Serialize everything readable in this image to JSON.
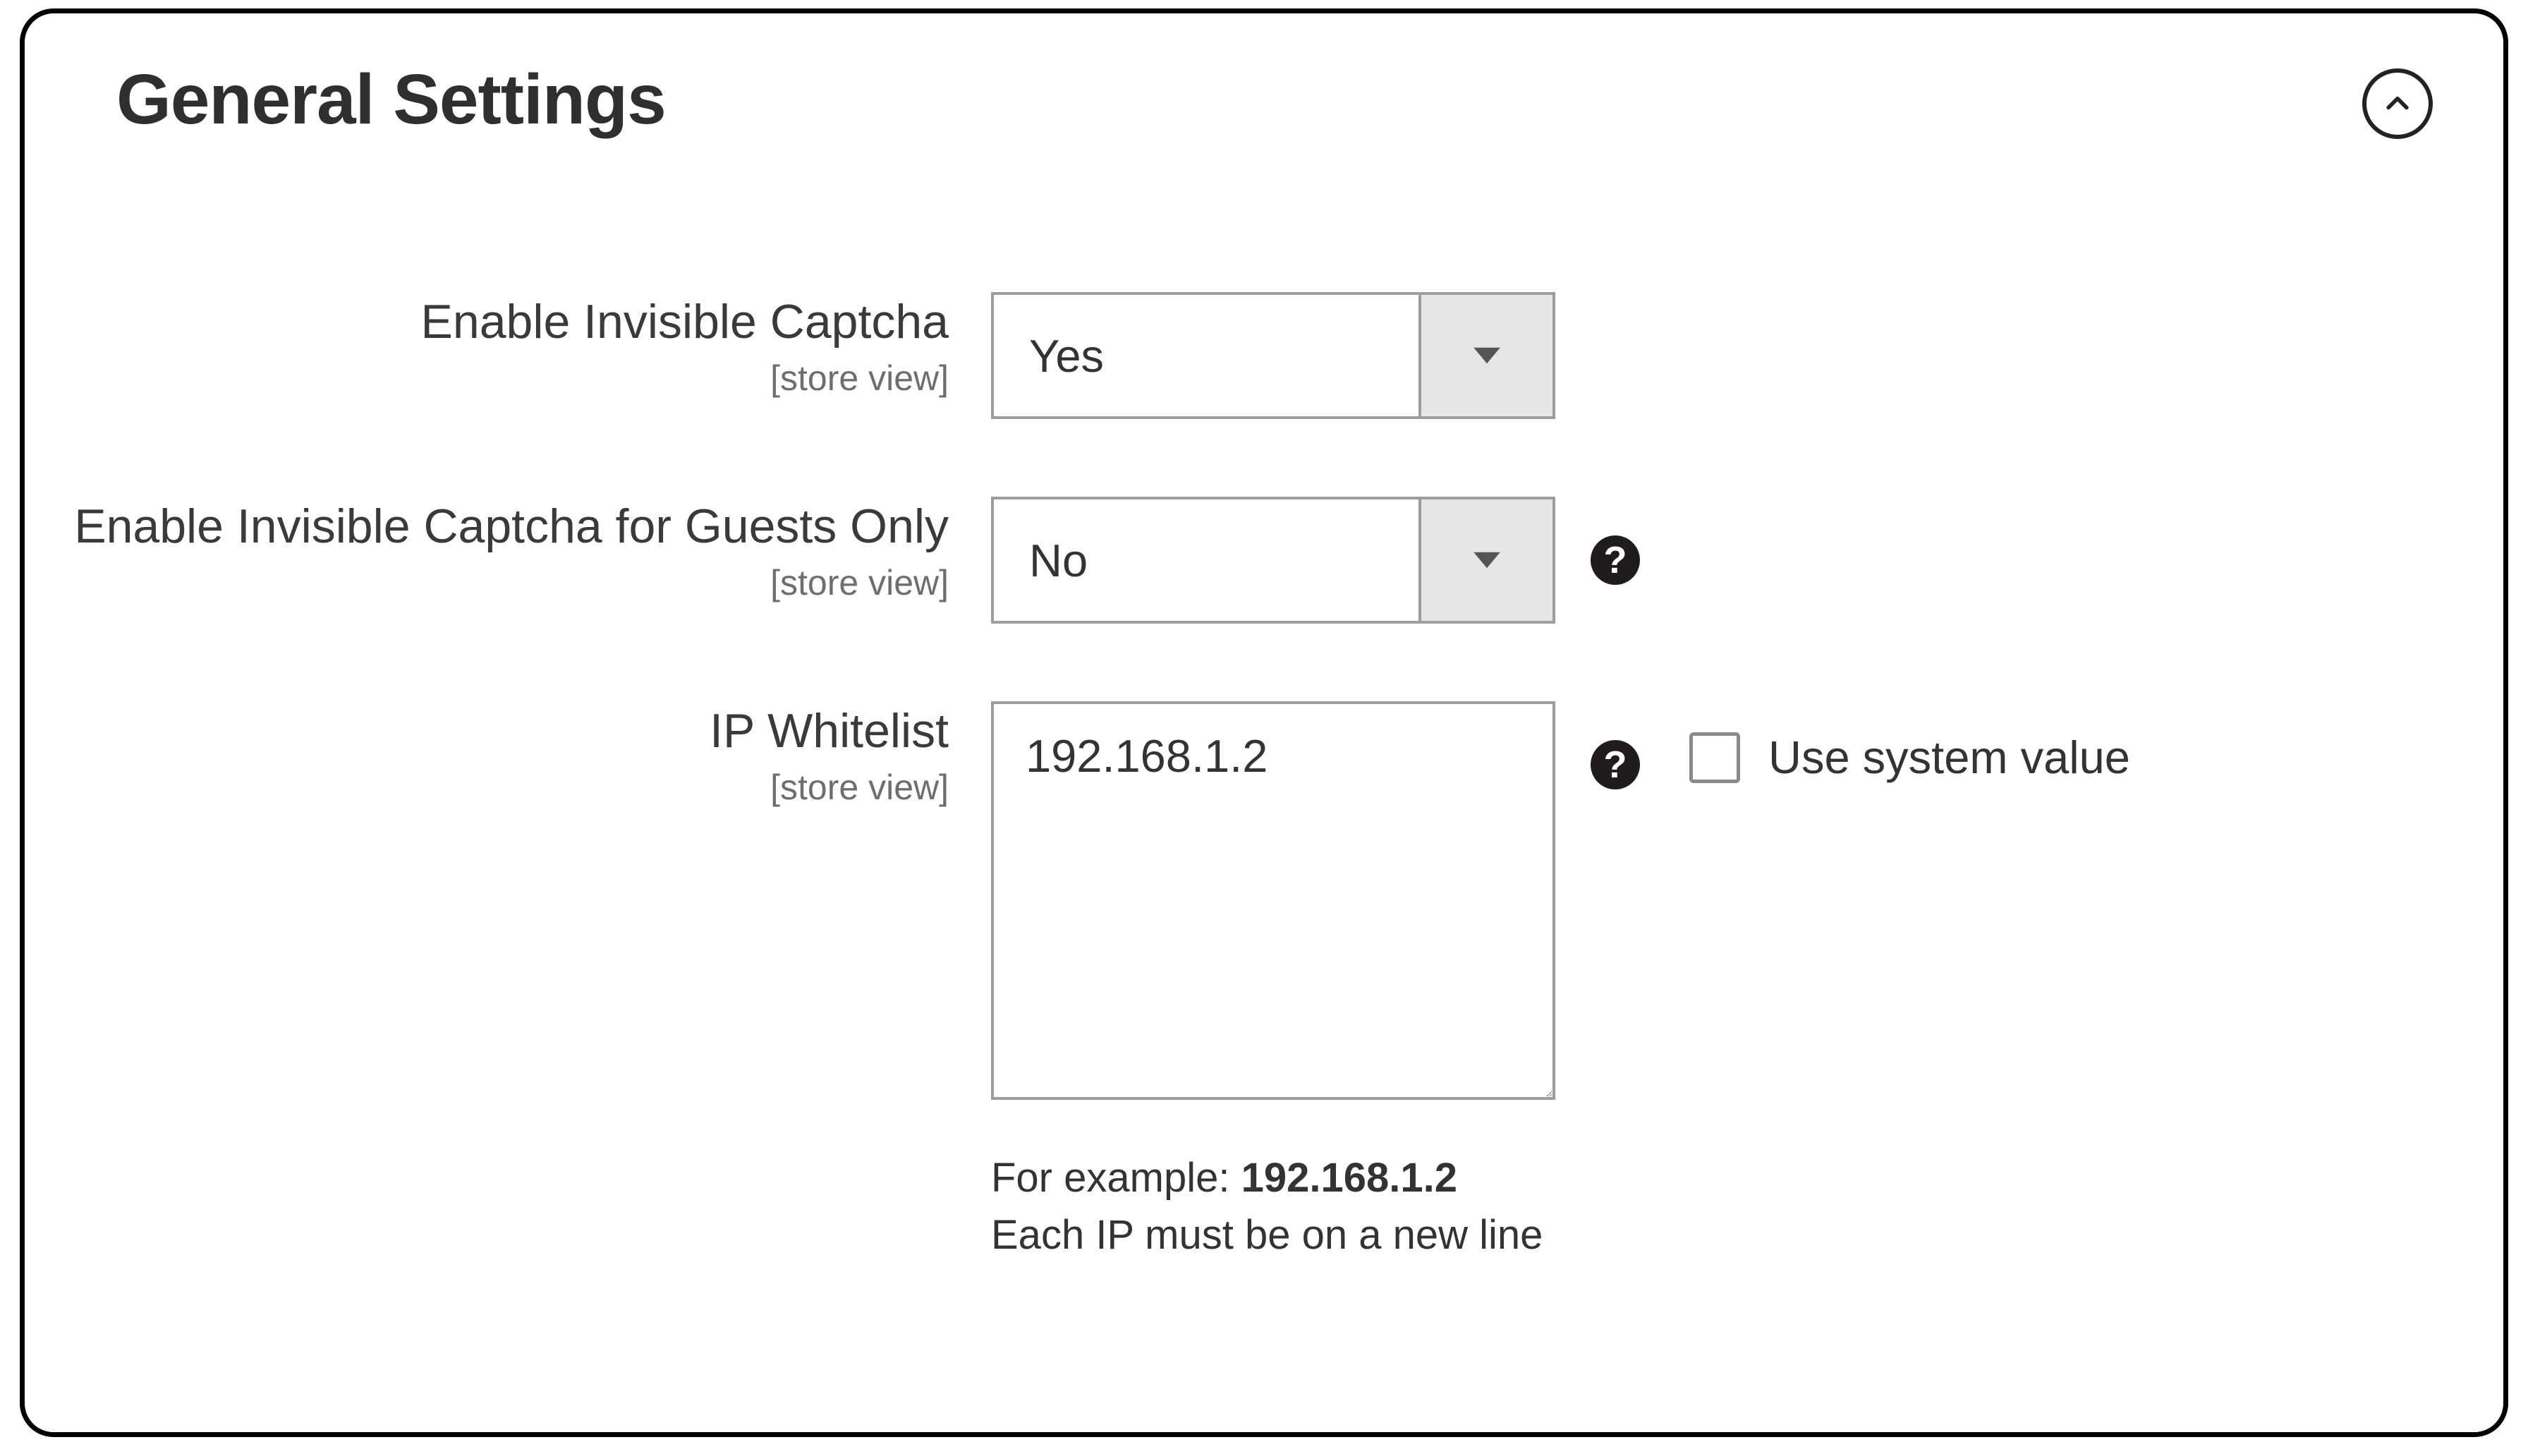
{
  "section": {
    "title": "General Settings"
  },
  "fields": {
    "enable": {
      "label": "Enable Invisible Captcha",
      "scope": "[store view]",
      "value": "Yes"
    },
    "guests": {
      "label": "Enable Invisible Captcha for Guests Only",
      "scope": "[store view]",
      "value": "No"
    },
    "whitelist": {
      "label": "IP Whitelist",
      "scope": "[store view]",
      "value": "192.168.1.2",
      "use_system_label": "Use system value",
      "hint_prefix": "For example: ",
      "hint_bold": "192.168.1.2",
      "hint_line2": "Each IP must be on a new line"
    }
  },
  "glyphs": {
    "help": "?"
  }
}
